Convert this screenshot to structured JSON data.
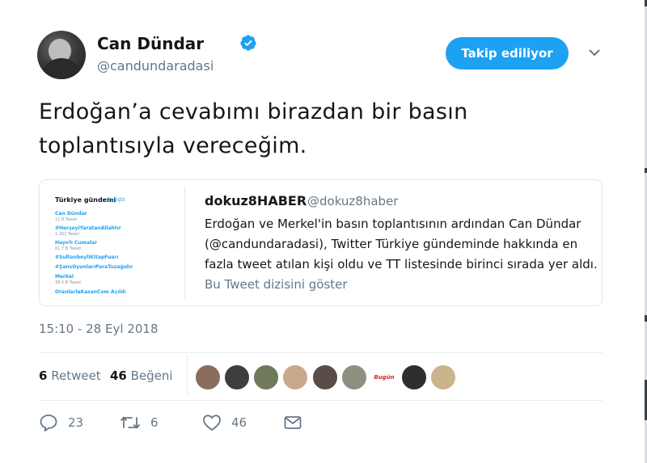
{
  "author": {
    "name": "Can Dündar",
    "handle": "@candundaradasi"
  },
  "follow_button_label": "Takip ediliyor",
  "tweet_text": "Erdoğan’a cevabımı birazdan bir basın toplantısıyla vereceğim.",
  "quote": {
    "image": {
      "heading": "Türkiye gündemi",
      "change": "Değiştir",
      "trends": [
        {
          "name": "Can Dündar",
          "count": "11,8 Tweet"
        },
        {
          "name": "#HerşeyiYaratanAllahtır",
          "count": "1.262 Tweet"
        },
        {
          "name": "Hayırlı Cumalar",
          "count": "61,7 B Tweet"
        },
        {
          "name": "#SultanbeyliKitapFuarı",
          "count": ""
        },
        {
          "name": "#ŞansOyunlarıParaTuzağıdır",
          "count": ""
        },
        {
          "name": "Merkel",
          "count": "38,5 B Tweet"
        },
        {
          "name": "OranlarlaKazanCom Açıldı",
          "count": ""
        }
      ]
    },
    "author_name": "dokuz8HABER",
    "author_handle": "@dokuz8haber",
    "text": "Erdoğan ve Merkel'in basın toplantısının ardından Can Dündar (@candundaradasi), Twitter Türkiye gündeminde hakkında en fazla tweet atılan kişi oldu ve TT listesinde birinci sırada yer aldı.",
    "thread_link": "Bu Tweet dizisini göster"
  },
  "timestamp": "15:10 - 28 Eyl 2018",
  "stats": {
    "retweets_count": "6",
    "retweets_label": "Retweet",
    "likes_count": "46",
    "likes_label": "Beğeni"
  },
  "liker_avatars": [
    "#8a6d5e",
    "#3e3e3e",
    "#6e7a5a",
    "#c9a98a",
    "#5a4c48",
    "#8f8f7f",
    "#d8232a",
    "#2e2e2e",
    "#c9b48c"
  ],
  "liker_badge": "Bugün",
  "actions": {
    "replies": "23",
    "retweets": "6",
    "likes": "46"
  },
  "colors": {
    "accent": "#1da1f2",
    "secondary_text": "#657786"
  },
  "icons": [
    "verified-icon",
    "chevron-down-icon",
    "reply-icon",
    "retweet-icon",
    "heart-icon",
    "message-icon"
  ]
}
